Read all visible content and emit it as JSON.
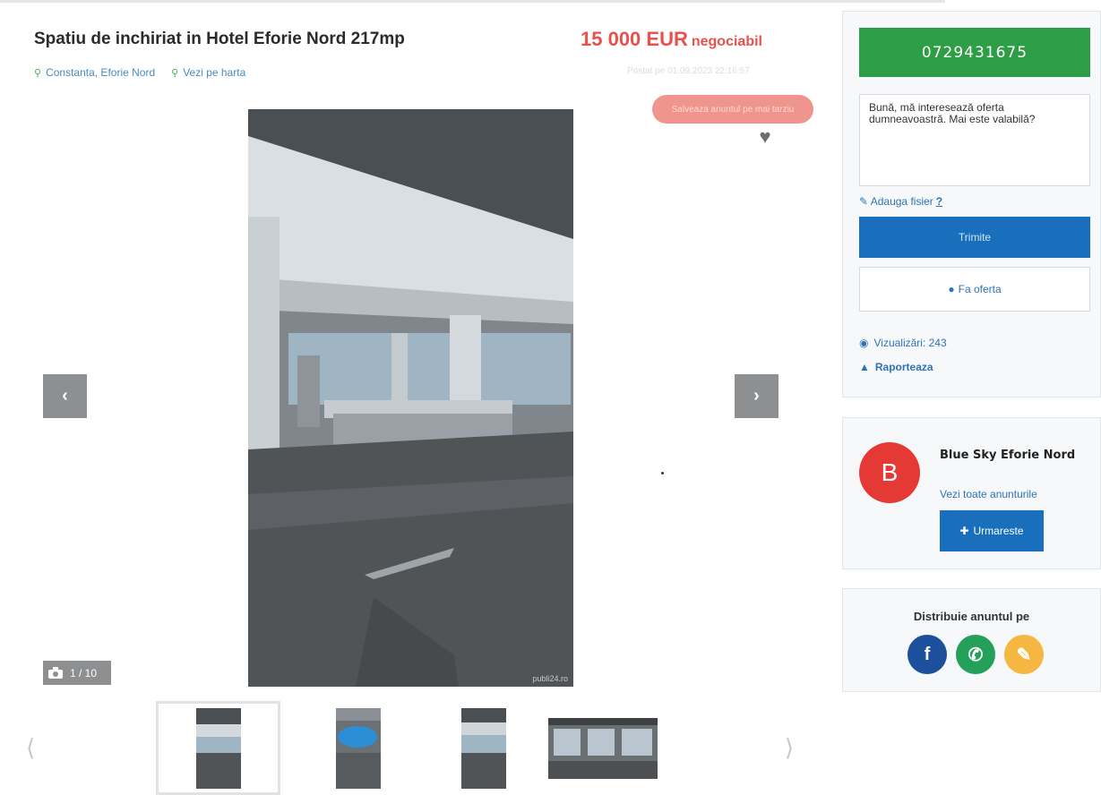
{
  "listing": {
    "title": "Spatiu de inchiriat in Hotel Eforie Nord 217mp",
    "price": "15 000 EUR",
    "price_note": "negociabil",
    "location": "Constanta, Eforie Nord",
    "map_link": "Vezi pe harta",
    "posted": "Postat pe 01.09.2023 22:16:57",
    "save_label": "Salveaza anuntul pe mai tarziu",
    "photo_counter": "1 / 10",
    "watermark": "publi24.ro"
  },
  "contact": {
    "phone": "0729431675",
    "message": "Bună, mă interesează oferta dumneavoastră. Mai este valabilă?",
    "attach_label": "Adauga fisier",
    "attach_help": "?",
    "send_label": "Trimite",
    "offer_label": "Fa oferta",
    "views_label": "Vizualizări: 243",
    "report_label": "Raporteaza"
  },
  "seller": {
    "initial": "B",
    "name": "Blue Sky Eforie Nord",
    "all_ads_link": "Vezi toate anunturile",
    "follow_label": "Urmareste"
  },
  "share": {
    "title": "Distribuie anuntul pe"
  },
  "colors": {
    "price": "#e8514c",
    "phone_button": "#2e9e46",
    "primary_button": "#1a6fbd",
    "avatar": "#e53935"
  }
}
